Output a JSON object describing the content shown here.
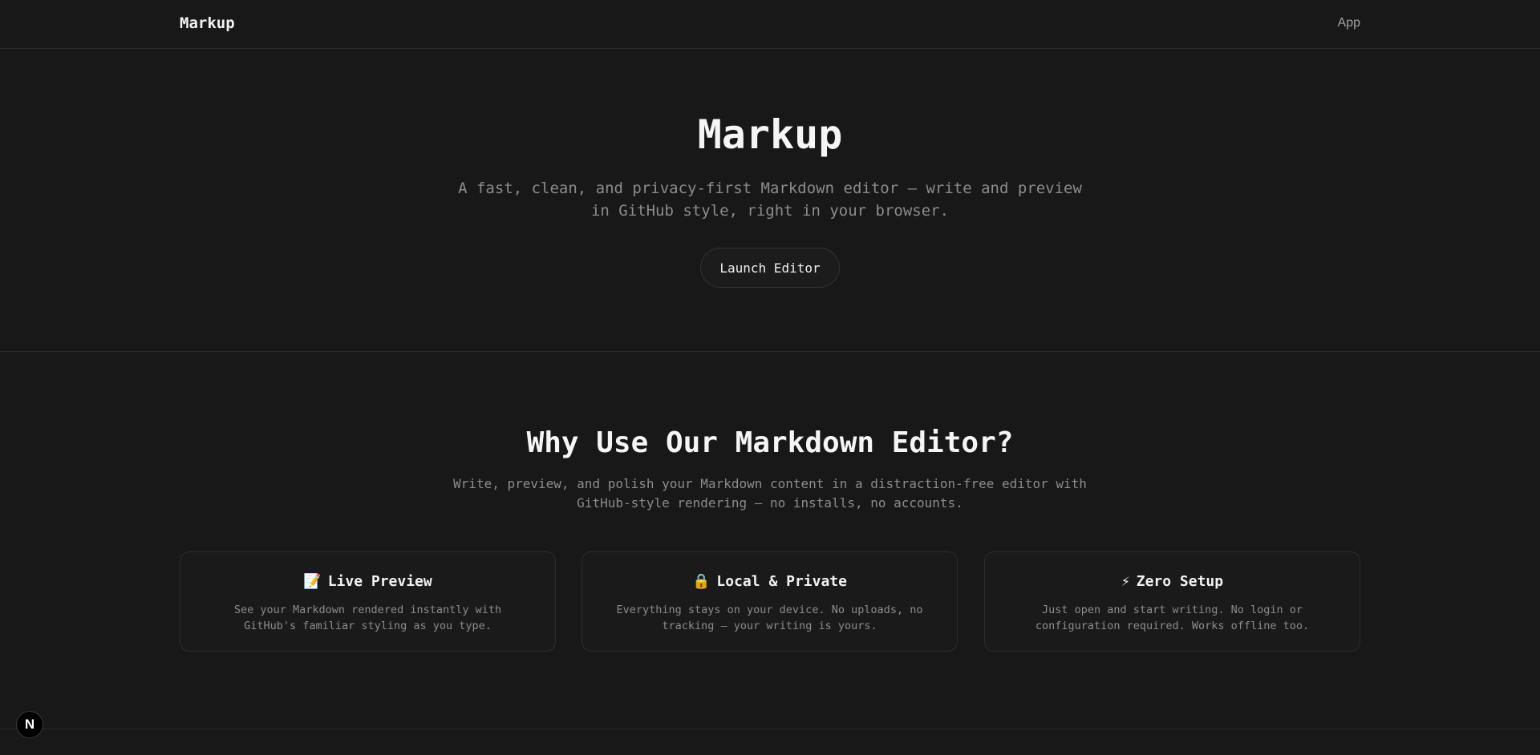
{
  "header": {
    "brand": "Markup",
    "nav_app": "App"
  },
  "hero": {
    "title": "Markup",
    "subtitle": "A fast, clean, and privacy-first Markdown editor — write and preview in GitHub style, right in your browser.",
    "cta_label": "Launch Editor"
  },
  "features": {
    "title": "Why Use Our Markdown Editor?",
    "subtitle": "Write, preview, and polish your Markdown content in a distraction-free editor with GitHub-style rendering — no installs, no accounts.",
    "cards": [
      {
        "icon": "memo-icon",
        "emoji": "📝",
        "title": "Live Preview",
        "description": "See your Markdown rendered instantly with GitHub's familiar styling as you type."
      },
      {
        "icon": "lock-icon",
        "emoji": "🔒",
        "title": "Local & Private",
        "description": "Everything stays on your device. No uploads, no tracking — your writing is yours."
      },
      {
        "icon": "lightning-icon",
        "emoji": "⚡",
        "title": "Zero Setup",
        "description": "Just open and start writing. No login or configuration required. Works offline too."
      }
    ]
  },
  "dev_badge": {
    "icon": "nextjs-icon",
    "letter": "N"
  },
  "colors": {
    "background": "#181818",
    "border": "#2a2a2a",
    "text_primary": "#ededed",
    "text_muted": "#8c8c8c"
  }
}
